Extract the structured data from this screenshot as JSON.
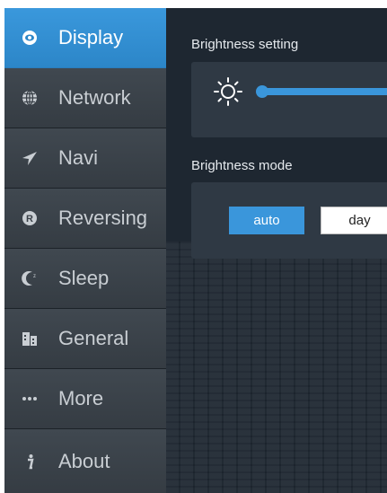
{
  "sidebar": {
    "items": [
      {
        "label": "Display",
        "icon": "eye-icon",
        "active": true
      },
      {
        "label": "Network",
        "icon": "globe-icon",
        "active": false
      },
      {
        "label": "Navi",
        "icon": "navigation-arrow-icon",
        "active": false
      },
      {
        "label": "Reversing",
        "icon": "reverse-r-icon",
        "active": false
      },
      {
        "label": "Sleep",
        "icon": "moon-icon",
        "active": false
      },
      {
        "label": "General",
        "icon": "building-icon",
        "active": false
      },
      {
        "label": "More",
        "icon": "more-dots-icon",
        "active": false
      },
      {
        "label": "About",
        "icon": "info-icon",
        "active": false
      }
    ]
  },
  "main": {
    "brightness_setting": {
      "title": "Brightness setting",
      "icon": "sun-icon",
      "level": 1.0
    },
    "brightness_mode": {
      "title": "Brightness mode",
      "options": [
        "auto",
        "day"
      ],
      "selected": "auto"
    }
  },
  "colors": {
    "accent": "#3a96db",
    "sidebar": "#3a4148",
    "background": "#1e2731"
  }
}
